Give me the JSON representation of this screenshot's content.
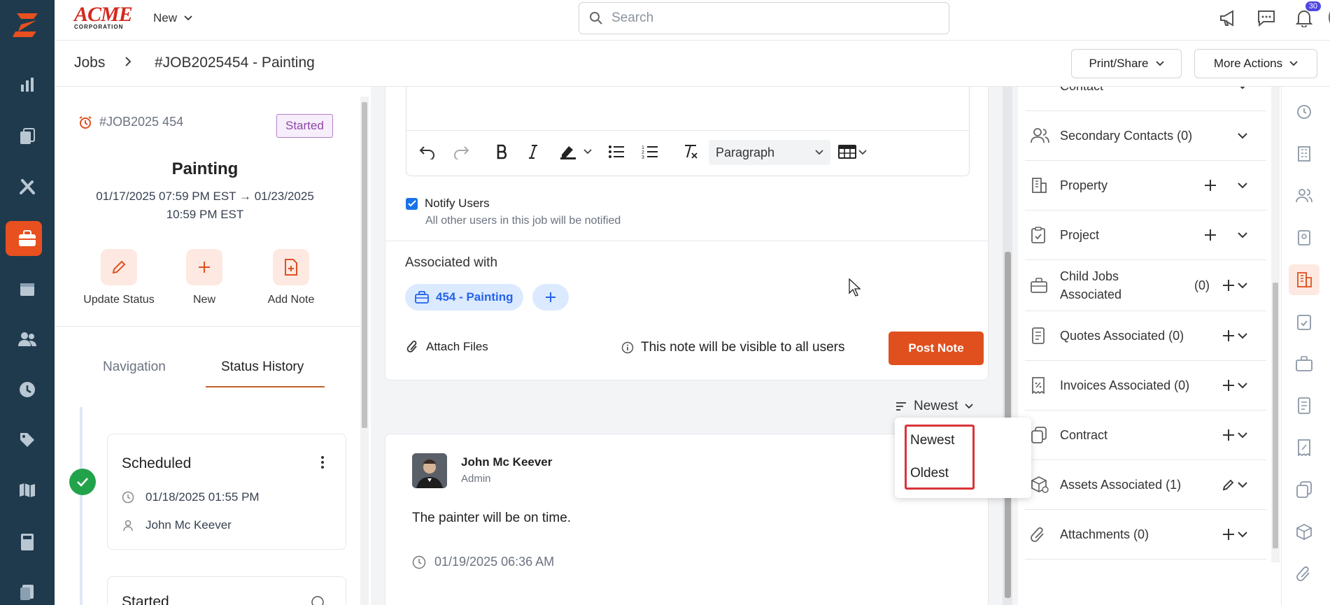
{
  "brand": {
    "name": "ACME",
    "sub": "CORPORATION"
  },
  "topbar": {
    "new_label": "New",
    "search_placeholder": "Search",
    "notification_count": "30"
  },
  "breadcrumb": {
    "parent": "Jobs",
    "current": "#JOB2025454 - Painting"
  },
  "header_actions": {
    "print_share": "Print/Share",
    "more_actions": "More Actions"
  },
  "job": {
    "id": "#JOB2025 454",
    "status": "Started",
    "name": "Painting",
    "dates_line1": "01/17/2025 07:59 PM EST → 01/23/2025",
    "dates_line2": "10:59 PM EST"
  },
  "job_actions": {
    "update_status": "Update Status",
    "new": "New",
    "add_note": "Add Note"
  },
  "tabs": {
    "navigation": "Navigation",
    "status_history": "Status History"
  },
  "status_history": [
    {
      "title": "Scheduled",
      "datetime": "01/18/2025 01:55 PM",
      "user": "John Mc Keever"
    },
    {
      "title": "Started"
    }
  ],
  "editor": {
    "block_format": "Paragraph"
  },
  "notify": {
    "label": "Notify Users",
    "sub": "All other users in this job will be notified"
  },
  "associated": {
    "title": "Associated with",
    "chip": "454 - Painting"
  },
  "compose": {
    "attach_files": "Attach Files",
    "visibility": "This note will be visible to all users",
    "post": "Post Note"
  },
  "sort": {
    "current": "Newest",
    "options": [
      "Newest",
      "Oldest"
    ]
  },
  "note": {
    "author": "John Mc Keever",
    "role": "Admin",
    "body": "The painter will be on time.",
    "time": "01/19/2025 06:36 AM"
  },
  "right_panel": {
    "partial_top": "Contact",
    "rows": [
      {
        "label": "Secondary Contacts (0)",
        "icon": "users-icon",
        "add": false
      },
      {
        "label": "Property",
        "icon": "building-icon",
        "add": true
      },
      {
        "label": "Project",
        "icon": "clipboard-icon",
        "add": true
      },
      {
        "label": "Child Jobs\nAssociated",
        "count": "(0)",
        "icon": "briefcase-icon",
        "add": true
      },
      {
        "label": "Quotes Associated (0)",
        "icon": "quote-icon",
        "add": true
      },
      {
        "label": "Invoices Associated (0)",
        "icon": "invoice-icon",
        "add": true
      },
      {
        "label": "Contract",
        "icon": "contract-icon",
        "add": true
      },
      {
        "label": "Assets Associated (1)",
        "icon": "asset-icon",
        "edit": true
      },
      {
        "label": "Attachments (0)",
        "icon": "paperclip-icon",
        "add": true
      }
    ]
  },
  "colors": {
    "accent": "#e0501f",
    "nav_bg": "#1f3a4d",
    "link_blue": "#2563eb",
    "highlight_red": "#d9343a"
  }
}
